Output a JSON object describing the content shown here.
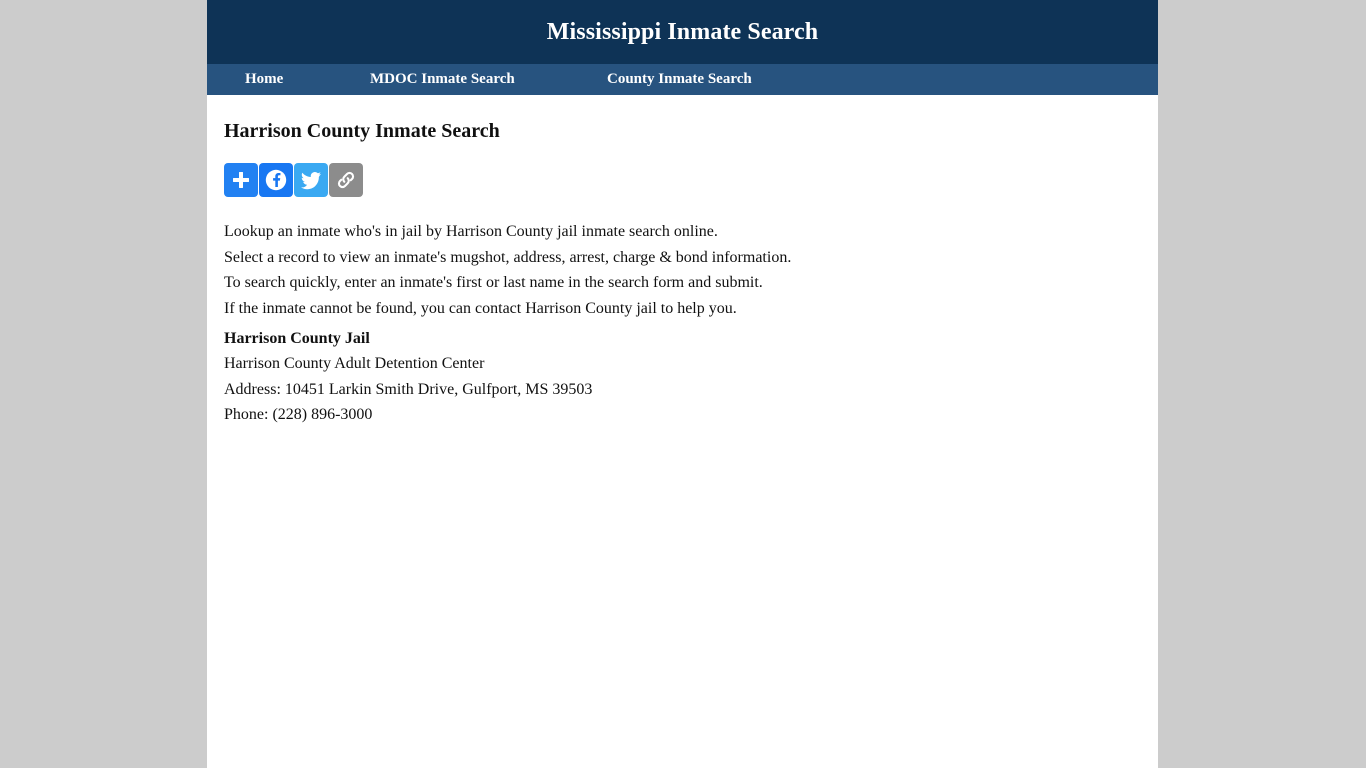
{
  "colors": {
    "page_background": "#cccccc",
    "content_background": "#ffffff",
    "masthead": "#0e3356",
    "navbar": "#27537f",
    "nav_text": "#ffffff",
    "body_text": "#111111",
    "addthis_blue": "#2281f2",
    "facebook_blue": "#1877f2",
    "twitter_blue": "#3aa9f2",
    "copylink_gray": "#8c8c8c"
  },
  "header": {
    "site_title": "Mississippi Inmate Search"
  },
  "nav": {
    "items": [
      {
        "label": "Home",
        "name": "nav-home"
      },
      {
        "label": "MDOC Inmate Search",
        "name": "nav-mdoc-inmate-search"
      },
      {
        "label": "County Inmate Search",
        "name": "nav-county-inmate-search"
      }
    ]
  },
  "main": {
    "page_heading": "Harrison County Inmate Search",
    "share": {
      "buttons": [
        {
          "icon": "addthis-plus-icon",
          "label": "Share",
          "color": "#2281f2"
        },
        {
          "icon": "facebook-icon",
          "label": "Facebook",
          "color": "#1877f2"
        },
        {
          "icon": "twitter-icon",
          "label": "Twitter",
          "color": "#3aa9f2"
        },
        {
          "icon": "copy-link-icon",
          "label": "Copy Link",
          "color": "#8c8c8c"
        }
      ]
    },
    "intro_lines": [
      "Lookup an inmate who's in jail by Harrison County jail inmate search online.",
      "Select a record to view an inmate's mugshot, address, arrest, charge & bond information.",
      "To search quickly, enter an inmate's first or last name in the search form and submit.",
      "If the inmate cannot be found, you can contact Harrison County jail to help you."
    ],
    "jail": {
      "heading": "Harrison County Jail",
      "facility": "Harrison County Adult Detention Center",
      "address": "Address: 10451 Larkin Smith Drive, Gulfport, MS 39503",
      "phone": "Phone: (228) 896-3000"
    }
  }
}
